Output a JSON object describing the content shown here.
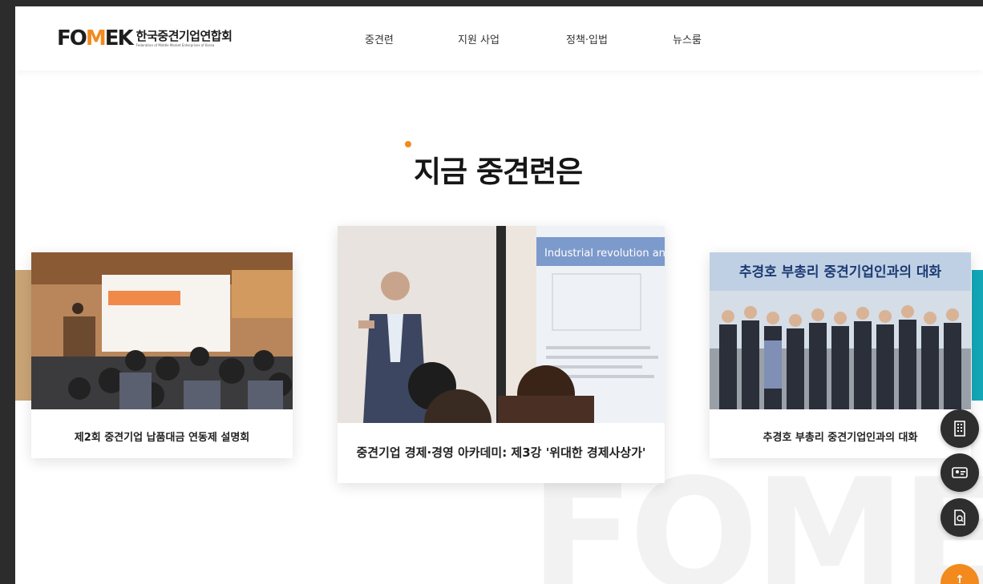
{
  "header": {
    "logo_mark": "FOMEK",
    "logo_name": "한국중견기업연합회",
    "logo_subtitle": "Federation of Middle Market Enterprises of Korea",
    "nav": [
      "중견련",
      "지원 사업",
      "정책·입법",
      "뉴스룸"
    ]
  },
  "section": {
    "title": "지금 중견련은"
  },
  "cards": [
    {
      "caption": "제2회 중견기업 납품대금 연동제 설명회",
      "image": "seminar-hall-photo"
    },
    {
      "caption": "중견기업 경제·경영 아카데미: 제3강 '위대한 경제사상가'",
      "image": "lecture-speaker-photo",
      "slide_text": "Industrial revolution and C"
    },
    {
      "caption": "추경호 부총리 중견기업인과의 대화",
      "image": "group-photo",
      "banner_text": "추경호 부총리 중견기업인과의 대화"
    }
  ],
  "watermark": "FOMEK",
  "quick_menu": [
    {
      "icon": "building-icon"
    },
    {
      "icon": "id-card-icon"
    },
    {
      "icon": "document-search-icon"
    }
  ],
  "scroll_top": "↑",
  "colors": {
    "accent": "#f28a1e",
    "dark": "#2e2e2e"
  }
}
